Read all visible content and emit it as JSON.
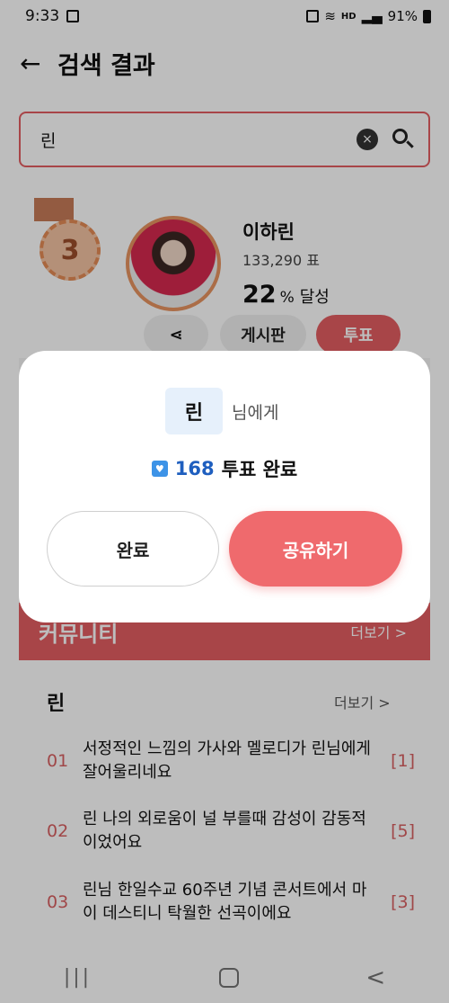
{
  "status_bar": {
    "time": "9:33",
    "network": "HD",
    "battery": "91%"
  },
  "app_bar": {
    "title": "검색 결과",
    "back_icon": "←"
  },
  "search": {
    "query": "린",
    "clear_icon": "×"
  },
  "rank_card": {
    "rank": "3",
    "name": "이하린",
    "votes": "133,290 표",
    "rate_value": "22",
    "rate_unit": "%",
    "rate_label": "달성",
    "share_icon": "⋖",
    "board_label": "게시판",
    "vote_label": "투표"
  },
  "community": {
    "title": "커뮤니티",
    "more": "더보기 >"
  },
  "list": {
    "title": "린",
    "more": "더보기 >",
    "posts": [
      {
        "num": "01",
        "text": "서정적인 느낌의 가사와 멜로디가 린님에게 잘어울리네요",
        "count": "[1]"
      },
      {
        "num": "02",
        "text": "린 나의 외로움이 널 부를때 감성이 감동적이었어요",
        "count": "[5]"
      },
      {
        "num": "03",
        "text": "린님 한일수교 60주년 기념 콘서트에서 마이 데스티니 탁월한 선곡이에요",
        "count": "[3]"
      }
    ]
  },
  "modal": {
    "recipient": "린",
    "recipient_suffix": "님에게",
    "vote_count": "168",
    "vote_done": "투표 완료",
    "done_label": "완료",
    "share_label": "공유하기"
  },
  "nav": {
    "recents": "|||",
    "back": "<"
  }
}
